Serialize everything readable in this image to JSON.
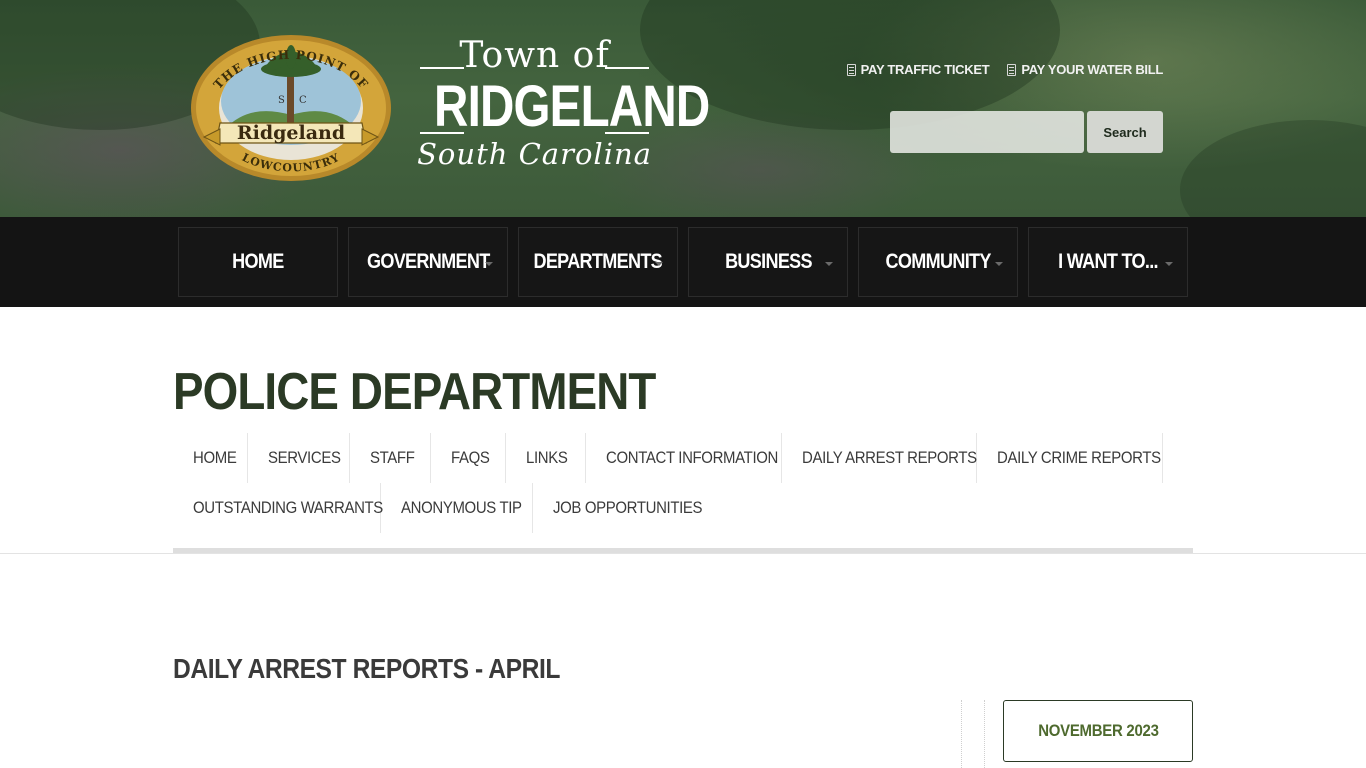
{
  "header": {
    "wordmark": {
      "line1": "Town of",
      "line2": "RIDGELAND",
      "line3": "South Carolina"
    },
    "seal": {
      "top_text": "THE HIGH POINT OF",
      "bottom_text": "LOWCOUNTRY",
      "banner_text": "Ridgeland",
      "state_left": "S",
      "state_right": "C"
    },
    "quicklinks": [
      {
        "label": "PAY TRAFFIC TICKET",
        "icon": "document-icon"
      },
      {
        "label": "PAY YOUR WATER BILL",
        "icon": "document-icon"
      }
    ],
    "search": {
      "placeholder": "",
      "value": "",
      "button_label": "Search"
    }
  },
  "mainnav": {
    "items": [
      {
        "label": "HOME",
        "has_dropdown": false
      },
      {
        "label": "GOVERNMENT",
        "has_dropdown": true
      },
      {
        "label": "DEPARTMENTS",
        "has_dropdown": true
      },
      {
        "label": "BUSINESS",
        "has_dropdown": true
      },
      {
        "label": "COMMUNITY",
        "has_dropdown": true
      },
      {
        "label": "I WANT TO...",
        "has_dropdown": true
      }
    ]
  },
  "page": {
    "title": "POLICE DEPARTMENT",
    "subnav": [
      "HOME",
      "SERVICES",
      "STAFF",
      "FAQS",
      "LINKS",
      "CONTACT INFORMATION",
      "DAILY ARREST REPORTS",
      "DAILY CRIME REPORTS",
      "OUTSTANDING WARRANTS",
      "ANONYMOUS TIP",
      "JOB OPPORTUNITIES"
    ],
    "content_heading": "DAILY ARREST REPORTS - APRIL",
    "sidebar": {
      "month_button": "NOVEMBER 2023"
    }
  },
  "colors": {
    "header_green": "#3d5a3a",
    "nav_black": "#141414",
    "title_green": "#2b3a25",
    "link_green": "#4e6a2e",
    "seal_gold": "#c79a2a"
  }
}
